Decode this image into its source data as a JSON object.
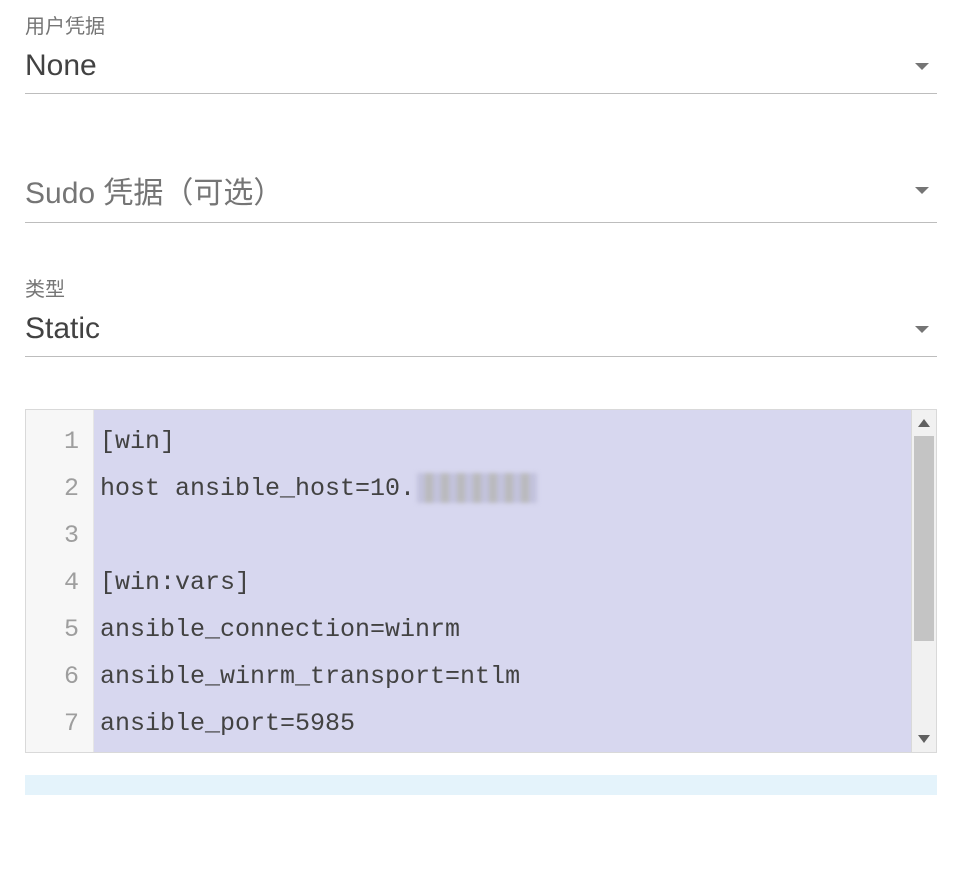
{
  "fields": {
    "user_credentials": {
      "label": "用户凭据",
      "value": "None"
    },
    "sudo_credentials": {
      "placeholder": "Sudo 凭据（可选）",
      "value": ""
    },
    "type": {
      "label": "类型",
      "value": "Static"
    }
  },
  "editor": {
    "line_numbers": [
      "1",
      "2",
      "3",
      "4",
      "5",
      "6",
      "7"
    ],
    "lines": [
      "[win]",
      "host ansible_host=10.",
      "",
      "[win:vars]",
      "ansible_connection=winrm",
      "ansible_winrm_transport=ntlm",
      "ansible_port=5985"
    ],
    "redacted_line_index": 1
  }
}
